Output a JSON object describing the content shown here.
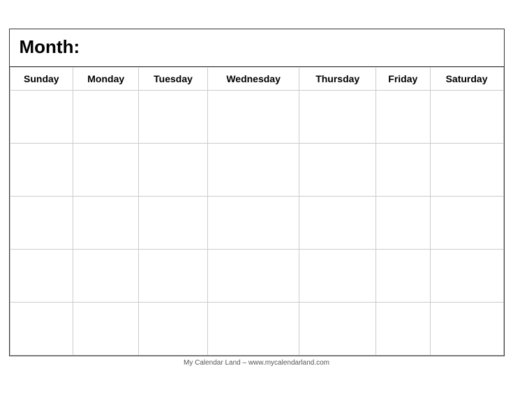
{
  "calendar": {
    "title": "Month:",
    "days": [
      "Sunday",
      "Monday",
      "Tuesday",
      "Wednesday",
      "Thursday",
      "Friday",
      "Saturday"
    ],
    "rows": 5,
    "footer": "My Calendar Land – www.mycalendarland.com"
  }
}
